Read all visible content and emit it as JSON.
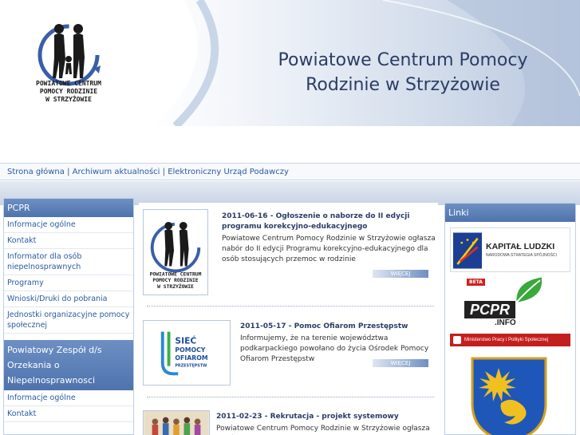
{
  "header": {
    "title_line1": "Powiatowe Centrum Pomocy",
    "title_line2": "Rodzinie w Strzyżowie",
    "logo_line1": "POWIATOWE CENTRUM",
    "logo_line2": "POMOCY RODZINIE",
    "logo_line3": "W STRZYŻOWIE"
  },
  "nav": {
    "items": [
      "Strona główna",
      "Archiwum aktualności",
      "Elektroniczny Urząd Podawczy"
    ],
    "separator": "|"
  },
  "left": {
    "section1": {
      "heading": "PCPR",
      "items": [
        "Informacje ogólne",
        "Kontakt",
        "Informator dla osób niepelnosprawnych",
        "Programy",
        "Wnioski/Druki do pobrania",
        "Jednostki organizacyjne pomocy społecznej"
      ]
    },
    "section2": {
      "heading": "Powiatowy Zespół d/s Orzekania o Niepelnosprawnosci",
      "items": [
        "Informacje ogólne",
        "Kontakt"
      ]
    }
  },
  "news": [
    {
      "title": "2011-06-16 - Ogłoszenie o naborze do II edycji programu korekcyjno-edukacyjnego",
      "text": "Powiatowe Centrum Pomocy Rodzinie w Strzyżowie ogłasza nabór do II edycji Programu korekcyjno-edukacyjnego dla osób stosujących przemoc w rodzinie",
      "more": "WIĘCEJ"
    },
    {
      "title": "2011-05-17 - Pomoc Ofiarom Przestępstw",
      "text": "Informujemy, że na terenie województwa podkarpackiego powołano do życia Ośrodek Pomocy Ofiarom Przestępstw",
      "more": "WIĘCEJ",
      "thumb_line1": "SIEĆ",
      "thumb_line2": "POMOCY",
      "thumb_line3": "OFIAROM",
      "thumb_line4": "PRZESTĘPSTW"
    },
    {
      "title": "2011-02-23 - Rekrutacja - projekt systemowy",
      "text": "Powiatowe Centrum Pomocy Rodzinie w Strzyżowie ogłasza nabór"
    }
  ],
  "right": {
    "heading": "Linki",
    "kapital_title": "KAPITAŁ LUDZKI",
    "kapital_sub": "NARODOWA STRATEGIA SPÓJNOŚCI",
    "beta": "BETA",
    "pcpr_info_line1": "PCPR",
    "pcpr_info_line2": ".INFO",
    "ministry": "Ministerstwo Pracy i Polityki Społecznej"
  },
  "colors": {
    "accent": "#4e73ad",
    "link": "#2a5aa0",
    "title": "#2a3d66"
  }
}
